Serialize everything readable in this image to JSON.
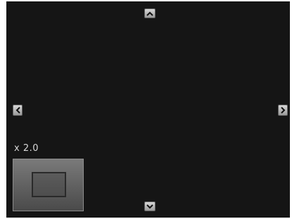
{
  "viewer": {
    "zoom_label": "x 2.0"
  },
  "controls": {
    "pan_up_icon": "chevron-up-icon",
    "pan_down_icon": "chevron-down-icon",
    "pan_left_icon": "chevron-left-icon",
    "pan_right_icon": "chevron-right-icon"
  },
  "colors": {
    "background": "#151515",
    "arrow_fill": "#bdbdbd",
    "label": "#d8d8d8",
    "navigator": "#5f5f5f"
  }
}
